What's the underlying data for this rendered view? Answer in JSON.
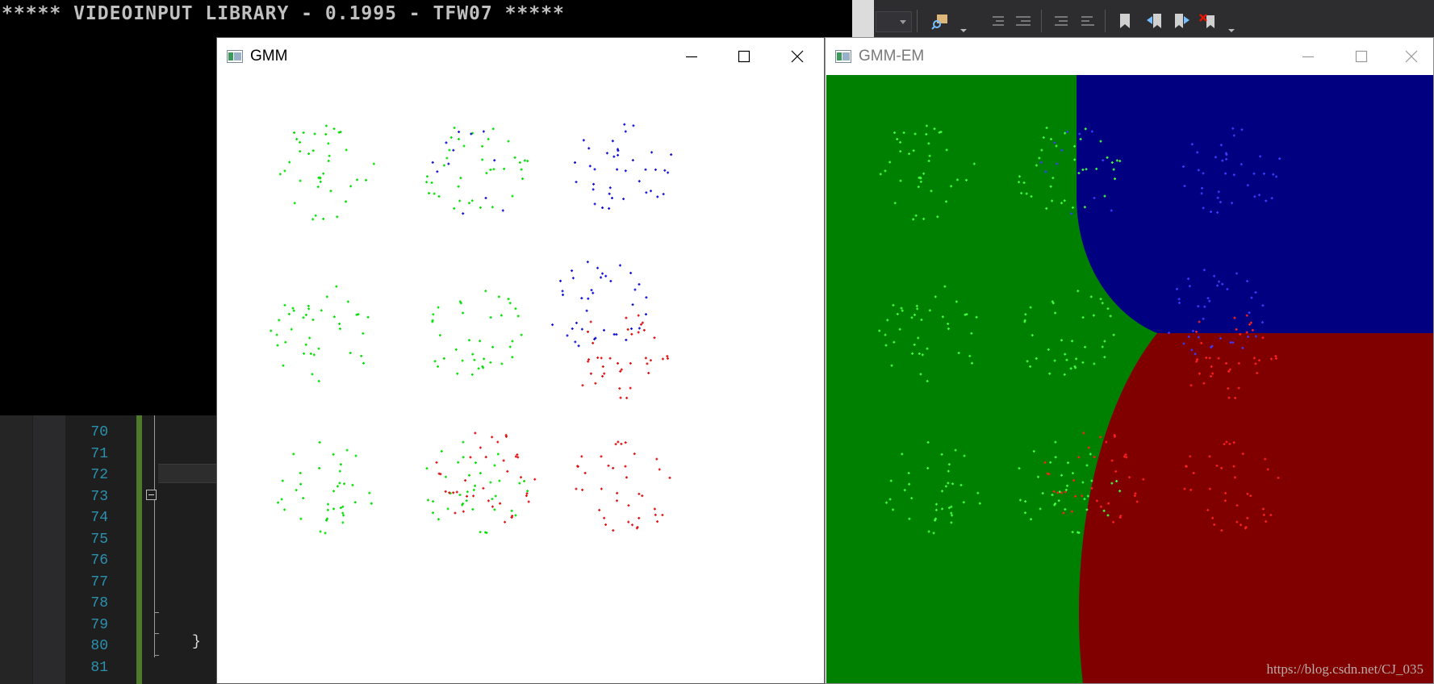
{
  "console": {
    "text": "***** VIDEOINPUT LIBRARY - 0.1995 - TFW07 *****"
  },
  "editor": {
    "line_numbers": [
      "70",
      "71",
      "72",
      "73",
      "74",
      "75",
      "76",
      "77",
      "78",
      "79",
      "80",
      "81"
    ],
    "closing_brace": "}"
  },
  "toolbar": {
    "buttons": [
      "find-in-files-icon",
      "outdent-icon",
      "indent-icon",
      "comment-icon",
      "uncomment-icon",
      "bookmark-icon",
      "prev-bookmark-icon",
      "next-bookmark-icon",
      "clear-bookmarks-icon"
    ]
  },
  "window_gmm": {
    "title": "GMM",
    "background": "#000000"
  },
  "window_em": {
    "title": "GMM-EM",
    "regions": {
      "green": "#008000",
      "blue": "#000080",
      "red": "#800000"
    }
  },
  "colors": {
    "point_green": "#00e000",
    "point_blue": "#1010d8",
    "point_red": "#e01010",
    "point_blue_em": "#3c3cff",
    "point_red_em": "#ff2020",
    "point_green_em": "#40ff40"
  },
  "watermark": "https://blog.csdn.net/CJ_035"
}
